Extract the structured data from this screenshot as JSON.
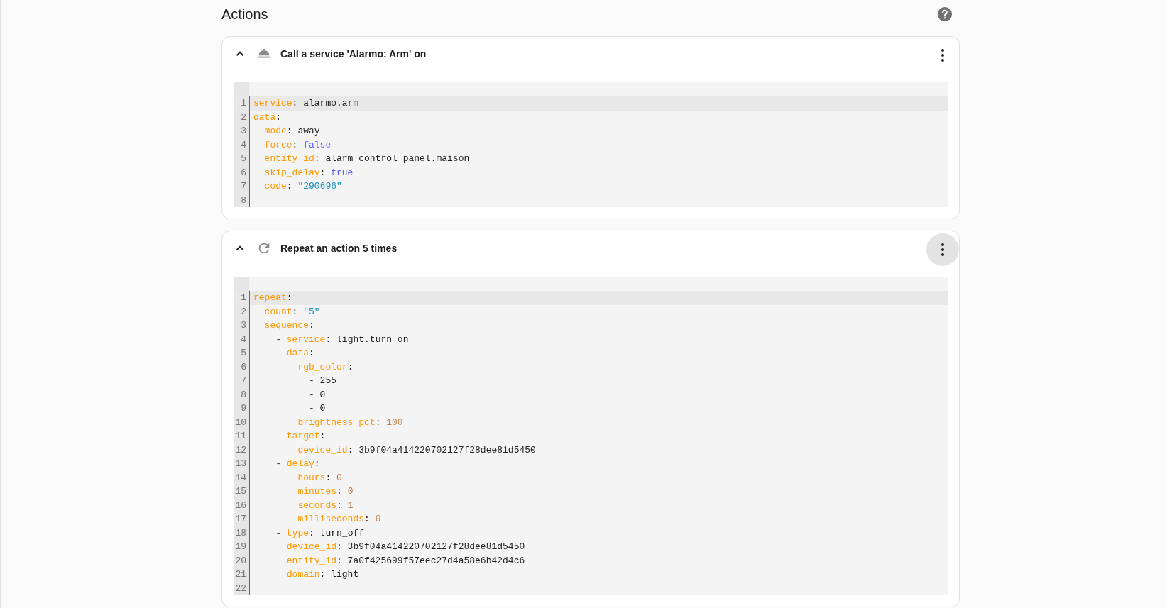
{
  "header": {
    "title": "Actions"
  },
  "actions": [
    {
      "title": "Call a service 'Alarmo: Arm' on",
      "kind": "service",
      "expanded": true,
      "menu_hovered": false,
      "lines": [
        {
          "number": "1",
          "active": true,
          "tokens": [
            {
              "kind": "key",
              "text": "service"
            },
            {
              "kind": "plain",
              "text": ": alarmo.arm"
            }
          ]
        },
        {
          "number": "2",
          "active": false,
          "tokens": [
            {
              "kind": "key",
              "text": "data"
            },
            {
              "kind": "plain",
              "text": ":"
            }
          ],
          "children": [
            {
              "number": "3",
              "active": false,
              "tokens": [
                {
                  "kind": "key",
                  "text": "mode"
                },
                {
                  "kind": "plain",
                  "text": ": away"
                }
              ]
            },
            {
              "number": "4",
              "active": false,
              "tokens": [
                {
                  "kind": "key",
                  "text": "force"
                },
                {
                  "kind": "plain",
                  "text": ": "
                },
                {
                  "kind": "bool",
                  "text": "false"
                }
              ]
            },
            {
              "number": "5",
              "active": false,
              "tokens": [
                {
                  "kind": "key",
                  "text": "entity_id"
                },
                {
                  "kind": "plain",
                  "text": ": alarm_control_panel.maison"
                }
              ]
            },
            {
              "number": "6",
              "active": false,
              "tokens": [
                {
                  "kind": "key",
                  "text": "skip_delay"
                },
                {
                  "kind": "plain",
                  "text": ": "
                },
                {
                  "kind": "bool",
                  "text": "true"
                }
              ]
            },
            {
              "number": "7",
              "active": false,
              "tokens": [
                {
                  "kind": "key",
                  "text": "code"
                },
                {
                  "kind": "plain",
                  "text": ": "
                },
                {
                  "kind": "string",
                  "text": "\"290696\""
                }
              ]
            }
          ]
        },
        {
          "number": "8",
          "active": false
        }
      ]
    },
    {
      "title": "Repeat an action 5 times",
      "kind": "repeat",
      "expanded": true,
      "menu_hovered": true,
      "lines": [
        {
          "number": "1",
          "active": true,
          "tokens": [
            {
              "kind": "key",
              "text": "repeat"
            },
            {
              "kind": "plain",
              "text": ":"
            }
          ],
          "children": [
            {
              "number": "2",
              "active": false,
              "tokens": [
                {
                  "kind": "key",
                  "text": "count"
                },
                {
                  "kind": "plain",
                  "text": ": "
                },
                {
                  "kind": "string",
                  "text": "\"5\""
                }
              ]
            },
            {
              "number": "3",
              "active": false,
              "tokens": [
                {
                  "kind": "key",
                  "text": "sequence"
                },
                {
                  "kind": "plain",
                  "text": ":"
                }
              ],
              "children": [
                {
                  "number": "4",
                  "active": false,
                  "kind": "list-item",
                  "tokens": [
                    {
                      "kind": "dash",
                      "text": "- "
                    },
                    {
                      "kind": "key",
                      "text": "service"
                    },
                    {
                      "kind": "plain",
                      "text": ": light.turn_on"
                    }
                  ],
                  "children": [
                    {
                      "number": "5",
                      "active": false,
                      "tokens": [
                        {
                          "kind": "key",
                          "text": "data"
                        },
                        {
                          "kind": "plain",
                          "text": ":"
                        }
                      ],
                      "children": [
                        {
                          "number": "6",
                          "active": false,
                          "tokens": [
                            {
                              "kind": "key",
                              "text": "rgb_color"
                            },
                            {
                              "kind": "plain",
                              "text": ":"
                            }
                          ],
                          "children": [
                            {
                              "number": "7",
                              "active": false,
                              "tokens": [
                                {
                                  "kind": "dash",
                                  "text": "- "
                                },
                                {
                                  "kind": "plain",
                                  "text": "255"
                                }
                              ]
                            },
                            {
                              "number": "8",
                              "active": false,
                              "tokens": [
                                {
                                  "kind": "dash",
                                  "text": "- "
                                },
                                {
                                  "kind": "plain",
                                  "text": "0"
                                }
                              ]
                            },
                            {
                              "number": "9",
                              "active": false,
                              "tokens": [
                                {
                                  "kind": "dash",
                                  "text": "- "
                                },
                                {
                                  "kind": "plain",
                                  "text": "0"
                                }
                              ]
                            }
                          ]
                        },
                        {
                          "number": "10",
                          "active": false,
                          "tokens": [
                            {
                              "kind": "key",
                              "text": "brightness_pct"
                            },
                            {
                              "kind": "plain",
                              "text": ": "
                            },
                            {
                              "kind": "number",
                              "text": "100"
                            }
                          ]
                        }
                      ]
                    },
                    {
                      "number": "11",
                      "active": false,
                      "tokens": [
                        {
                          "kind": "key",
                          "text": "target"
                        },
                        {
                          "kind": "plain",
                          "text": ":"
                        }
                      ],
                      "children": [
                        {
                          "number": "12",
                          "active": false,
                          "tokens": [
                            {
                              "kind": "key",
                              "text": "device_id"
                            },
                            {
                              "kind": "plain",
                              "text": ": 3b9f04a414220702127f28dee81d5450"
                            }
                          ]
                        }
                      ]
                    }
                  ]
                },
                {
                  "number": "13",
                  "active": false,
                  "kind": "list-item-key",
                  "tokens": [
                    {
                      "kind": "dash",
                      "text": "- "
                    },
                    {
                      "kind": "key",
                      "text": "delay"
                    },
                    {
                      "kind": "plain",
                      "text": ":"
                    }
                  ],
                  "children": [
                    {
                      "number": "14",
                      "active": false,
                      "tokens": [
                        {
                          "kind": "key",
                          "text": "hours"
                        },
                        {
                          "kind": "plain",
                          "text": ": "
                        },
                        {
                          "kind": "number",
                          "text": "0"
                        }
                      ]
                    },
                    {
                      "number": "15",
                      "active": false,
                      "tokens": [
                        {
                          "kind": "key",
                          "text": "minutes"
                        },
                        {
                          "kind": "plain",
                          "text": ": "
                        },
                        {
                          "kind": "number",
                          "text": "0"
                        }
                      ]
                    },
                    {
                      "number": "16",
                      "active": false,
                      "tokens": [
                        {
                          "kind": "key",
                          "text": "seconds"
                        },
                        {
                          "kind": "plain",
                          "text": ": "
                        },
                        {
                          "kind": "number",
                          "text": "1"
                        }
                      ]
                    },
                    {
                      "number": "17",
                      "active": false,
                      "tokens": [
                        {
                          "kind": "key",
                          "text": "milliseconds"
                        },
                        {
                          "kind": "plain",
                          "text": ": "
                        },
                        {
                          "kind": "number",
                          "text": "0"
                        }
                      ]
                    }
                  ]
                },
                {
                  "number": "18",
                  "active": false,
                  "kind": "list-item",
                  "tokens": [
                    {
                      "kind": "dash",
                      "text": "- "
                    },
                    {
                      "kind": "key",
                      "text": "type"
                    },
                    {
                      "kind": "plain",
                      "text": ": turn_off"
                    }
                  ],
                  "children": [
                    {
                      "number": "19",
                      "active": false,
                      "tokens": [
                        {
                          "kind": "key",
                          "text": "device_id"
                        },
                        {
                          "kind": "plain",
                          "text": ": 3b9f04a414220702127f28dee81d5450"
                        }
                      ]
                    },
                    {
                      "number": "20",
                      "active": false,
                      "tokens": [
                        {
                          "kind": "key",
                          "text": "entity_id"
                        },
                        {
                          "kind": "plain",
                          "text": ": 7a0f425699f57eec27d4a58e6b42d4c6"
                        }
                      ]
                    },
                    {
                      "number": "21",
                      "active": false,
                      "tokens": [
                        {
                          "kind": "key",
                          "text": "domain"
                        },
                        {
                          "kind": "plain",
                          "text": ": light"
                        }
                      ]
                    }
                  ]
                }
              ]
            }
          ]
        },
        {
          "number": "22",
          "active": false
        }
      ]
    }
  ]
}
